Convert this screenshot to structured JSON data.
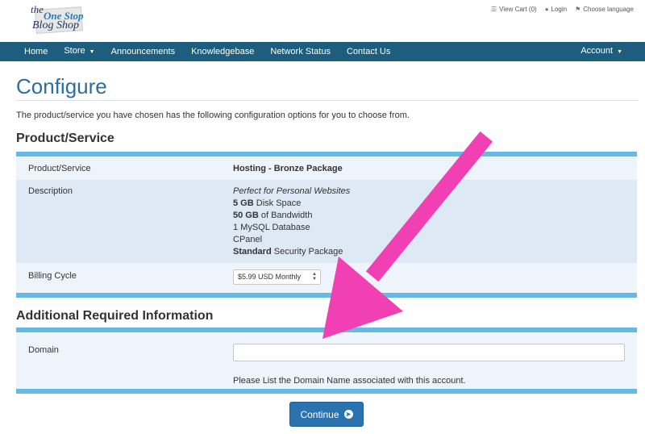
{
  "brand": {
    "logo_the": "the",
    "logo_onestop": "One Stop",
    "logo_blogshop": "Blog Shop"
  },
  "toplinks": {
    "cart": "View Cart (0)",
    "login": "Login",
    "language": "Choose language"
  },
  "nav": {
    "home": "Home",
    "store": "Store",
    "announcements": "Announcements",
    "knowledgebase": "Knowledgebase",
    "network_status": "Network Status",
    "contact_us": "Contact Us",
    "account": "Account"
  },
  "page": {
    "title": "Configure",
    "intro": "The product/service you have chosen has the following configuration options for you to choose from."
  },
  "product_section": {
    "heading": "Product/Service",
    "product_label": "Product/Service",
    "product_value": "Hosting - Bronze Package",
    "description_label": "Description",
    "description": {
      "tagline": "Perfect for Personal Websites",
      "disk_amount": "5 GB",
      "disk_text": " Disk Space",
      "bandwidth_amount": "50 GB",
      "bandwidth_text": " of Bandwidth",
      "database": "1 MySQL Database",
      "cpanel": "CPanel",
      "security_level": "Standard",
      "security_text": " Security Package"
    },
    "billing_label": "Billing Cycle",
    "billing_selected": "$5.99 USD Monthly"
  },
  "additional_section": {
    "heading": "Additional Required Information",
    "domain_label": "Domain",
    "domain_value": "",
    "domain_help": "Please List the Domain Name associated with this account."
  },
  "actions": {
    "continue_label": "Continue",
    "continue_icon": "arrow-circle-right-icon"
  },
  "colors": {
    "nav_bg": "#1d5d7e",
    "title": "#2a6fa0",
    "panel_border": "#65b9e7",
    "button": "#2a73b0",
    "annotation_arrow": "#f040b4"
  }
}
